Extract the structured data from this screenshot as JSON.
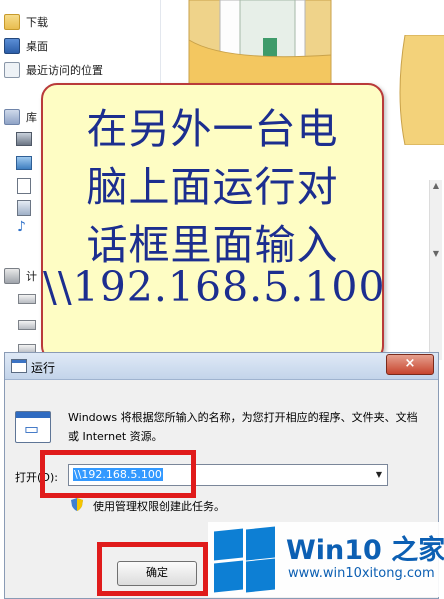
{
  "explorer": {
    "nav_items": [
      {
        "label": "下载",
        "icon": "folder-icon"
      },
      {
        "label": "桌面",
        "icon": "desktop-icon"
      },
      {
        "label": "最近访问的位置",
        "icon": "recent-places-icon"
      },
      {
        "label": "库",
        "icon": "library-icon"
      },
      {
        "label": "计",
        "icon": "computer-icon"
      }
    ]
  },
  "callout": {
    "lines": [
      "在另外一台电",
      "脑上面运行对",
      "话框里面输入",
      "\\\\192.168.5.100"
    ]
  },
  "run_dialog": {
    "title": "运行",
    "description": "Windows 将根据您所输入的名称，为您打开相应的程序、文件夹、文档或 Internet 资源。",
    "open_label": "打开(O):",
    "open_value": "\\\\192.168.5.100",
    "admin_note": "使用管理权限创建此任务。",
    "ok_label": "确定",
    "close_label": "×"
  },
  "watermark": {
    "brand": "Win10 之家",
    "url": "www.win10xitong.com"
  },
  "colors": {
    "highlight": "#e01b1b",
    "callout_text": "#1c2e8f",
    "callout_bg": "#fefdc4",
    "brand_blue": "#0d7fd4"
  }
}
